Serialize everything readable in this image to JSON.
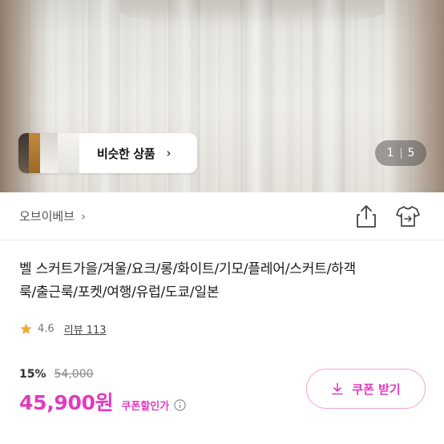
{
  "hero": {
    "similar_label": "비슷한 상품",
    "similar_chevron": "›",
    "counter_current": "1",
    "counter_total": "5"
  },
  "seller": {
    "name": "오브이베브",
    "chevron": "›",
    "share_icon": "share-icon",
    "action_icon": "tshirt-icon"
  },
  "product": {
    "title_line1": "벨 스커트가을/겨울/요크/롱/화이트/기모/플레어/스커트/하객",
    "title_line2": "룩/출근룩/포켓/여행/유럽/도쿄/일본",
    "rating": "4.6",
    "review_label": "리뷰 113"
  },
  "price": {
    "discount": "15%",
    "original": "54,000",
    "final": "45,900원",
    "coupon_price_label": "쿠폰할인가",
    "coupon_button_label": "쿠폰 받기"
  },
  "colors": {
    "accent": "#e23bbf",
    "accent_border": "#f0a4d9",
    "star": "#f2a93b"
  }
}
